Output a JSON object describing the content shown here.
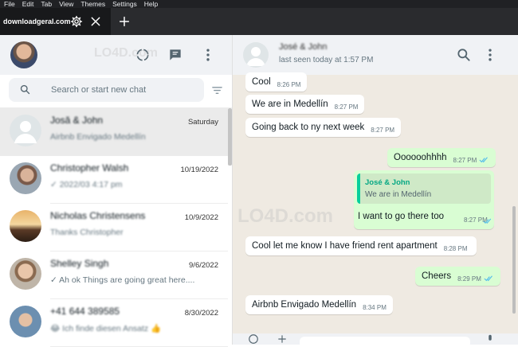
{
  "menu": [
    "File",
    "Edit",
    "Tab",
    "View",
    "Themes",
    "Settings",
    "Help"
  ],
  "tab": {
    "title": "downloadgeral.com"
  },
  "left_header": {},
  "search": {
    "placeholder": "Search or start new chat"
  },
  "chats": [
    {
      "name": "Josă & John",
      "date": "Saturday",
      "preview": "Airbnb Envigado Medellín",
      "blurred_preview": true
    },
    {
      "name": "Christopher Walsh",
      "date": "10/19/2022",
      "preview": "✓ 2022/03 4:17 pm",
      "blurred_preview": true
    },
    {
      "name": "Nicholas Christensens",
      "date": "10/9/2022",
      "preview": "Thanks Christopher",
      "blurred_preview": true
    },
    {
      "name": "Shelley Singh",
      "date": "9/6/2022",
      "preview": "✓ Ah ok Things are going great here....",
      "blurred_preview": false
    },
    {
      "name": "+41 644 389585",
      "date": "8/30/2022",
      "preview": "😂 Ich finde diesen Ansatz 👍",
      "blurred_preview": true
    }
  ],
  "conversation": {
    "contact_name": "José & John",
    "status": "last seen today at 1:57 PM",
    "messages": [
      {
        "dir": "in",
        "text": "Cool",
        "time": "8:26 PM"
      },
      {
        "dir": "in",
        "text": "We are in Medellín",
        "time": "8:27 PM"
      },
      {
        "dir": "in",
        "text": "Going back to ny next week",
        "time": "8:27 PM"
      },
      {
        "dir": "out",
        "text": "Oooooohhhh",
        "time": "8:27 PM"
      },
      {
        "dir": "in",
        "text": "Cool let me know I have friend rent apartment",
        "time": "8:28 PM"
      },
      {
        "dir": "out",
        "text": "Cheers",
        "time": "8:29 PM"
      },
      {
        "dir": "in",
        "text": "Airbnb Envigado Medellín",
        "time": "8:34 PM"
      }
    ],
    "reply": {
      "quoted_name": "José & John",
      "quoted_text": "We are in Medellín",
      "text": "I want to go there too",
      "time": "8:27 PM"
    }
  },
  "watermark": "LO4D.com",
  "colors": {
    "accent": "#06cf9c",
    "out_bubble": "#d9fdd3",
    "chat_bg": "#efeae2",
    "tick_blue": "#53bdeb"
  }
}
